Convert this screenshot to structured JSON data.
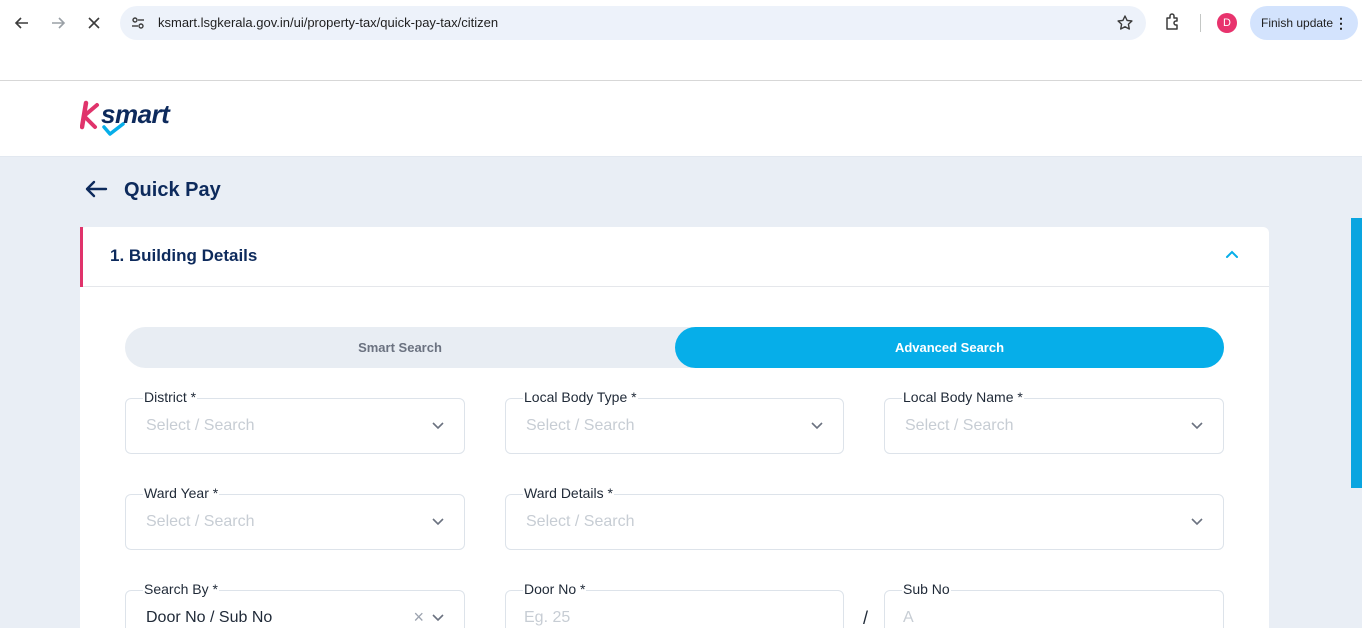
{
  "browser": {
    "url": "ksmart.lsgkerala.gov.in/ui/property-tax/quick-pay-tax/citizen",
    "avatar_letter": "D",
    "finish_update_label": "Finish update"
  },
  "header": {
    "logo_text": "Ksmart"
  },
  "page": {
    "title": "Quick Pay"
  },
  "section": {
    "title": "1. Building Details"
  },
  "search_toggle": {
    "smart_label": "Smart Search",
    "advanced_label": "Advanced Search",
    "active": "Advanced Search"
  },
  "form": {
    "district": {
      "label": "District *",
      "placeholder": "Select / Search"
    },
    "local_body_type": {
      "label": "Local Body Type *",
      "placeholder": "Select / Search"
    },
    "local_body_name": {
      "label": "Local Body Name *",
      "placeholder": "Select / Search"
    },
    "ward_year": {
      "label": "Ward Year *",
      "placeholder": "Select / Search"
    },
    "ward_details": {
      "label": "Ward Details *",
      "placeholder": "Select / Search"
    },
    "search_by": {
      "label": "Search By *",
      "value": "Door No / Sub No"
    },
    "door_no": {
      "label": "Door No *",
      "placeholder": "Eg. 25"
    },
    "separator": "/",
    "sub_no": {
      "label": "Sub No",
      "placeholder": "A"
    }
  },
  "colors": {
    "accent": "#06aee9",
    "brand_pink": "#e0336b",
    "title_navy": "#0d2a5c",
    "page_bg": "#e9eef5"
  }
}
